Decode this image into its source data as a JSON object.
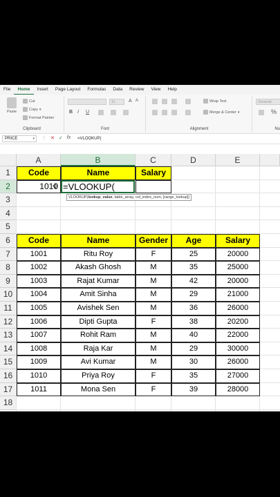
{
  "menu": [
    "File",
    "Home",
    "Insert",
    "Page Layout",
    "Formulas",
    "Data",
    "Review",
    "View",
    "Help"
  ],
  "active_menu": "Home",
  "ribbon": {
    "clipboard": {
      "cut": "Cut",
      "copy": "Copy",
      "paste": "Paste",
      "format_painter": "Format Painter",
      "label": "Clipboard"
    },
    "font": {
      "size": "11",
      "bold": "B",
      "italic": "I",
      "underline": "U",
      "label": "Font"
    },
    "alignment": {
      "wrap": "Wrap Text",
      "merge": "Merge & Center",
      "label": "Alignment"
    },
    "number": {
      "format": "General",
      "label": "Nu"
    }
  },
  "formula_bar": {
    "name_box": "PRICE",
    "formula": "=VLOOKUP("
  },
  "columns": [
    "A",
    "B",
    "C",
    "D",
    "E"
  ],
  "rows": [
    "1",
    "2",
    "3",
    "4",
    "5",
    "6",
    "7",
    "8",
    "9",
    "10",
    "11",
    "12",
    "13",
    "14",
    "15",
    "16",
    "17",
    "18"
  ],
  "lookup": {
    "headers": [
      "Code",
      "Name",
      "Salary"
    ],
    "code_value": "1010",
    "editing": "=VLOOKUP(",
    "tooltip_fn": "VLOOKUP(",
    "tooltip_arg1": "lookup_value",
    "tooltip_rest": ", table_array, col_index_num, [range_lookup])"
  },
  "table": {
    "headers": [
      "Code",
      "Name",
      "Gender",
      "Age",
      "Salary"
    ],
    "rows": [
      [
        "1001",
        "Ritu Roy",
        "F",
        "25",
        "20000"
      ],
      [
        "1002",
        "Akash Ghosh",
        "M",
        "35",
        "25000"
      ],
      [
        "1003",
        "Rajat Kumar",
        "M",
        "42",
        "20000"
      ],
      [
        "1004",
        "Amit Sinha",
        "M",
        "29",
        "21000"
      ],
      [
        "1005",
        "Avishek Sen",
        "M",
        "36",
        "26000"
      ],
      [
        "1006",
        "Dipti Gupta",
        "F",
        "38",
        "20200"
      ],
      [
        "1007",
        "Rohit Ram",
        "M",
        "40",
        "22000"
      ],
      [
        "1008",
        "Raja Kar",
        "M",
        "29",
        "30000"
      ],
      [
        "1009",
        "Avi Kumar",
        "M",
        "30",
        "26000"
      ],
      [
        "1010",
        "Priya Roy",
        "F",
        "35",
        "27000"
      ],
      [
        "1011",
        "Mona Sen",
        "F",
        "39",
        "28000"
      ]
    ]
  },
  "colors": {
    "accent": "#1e6e3b",
    "header_fill": "#ffff00"
  }
}
